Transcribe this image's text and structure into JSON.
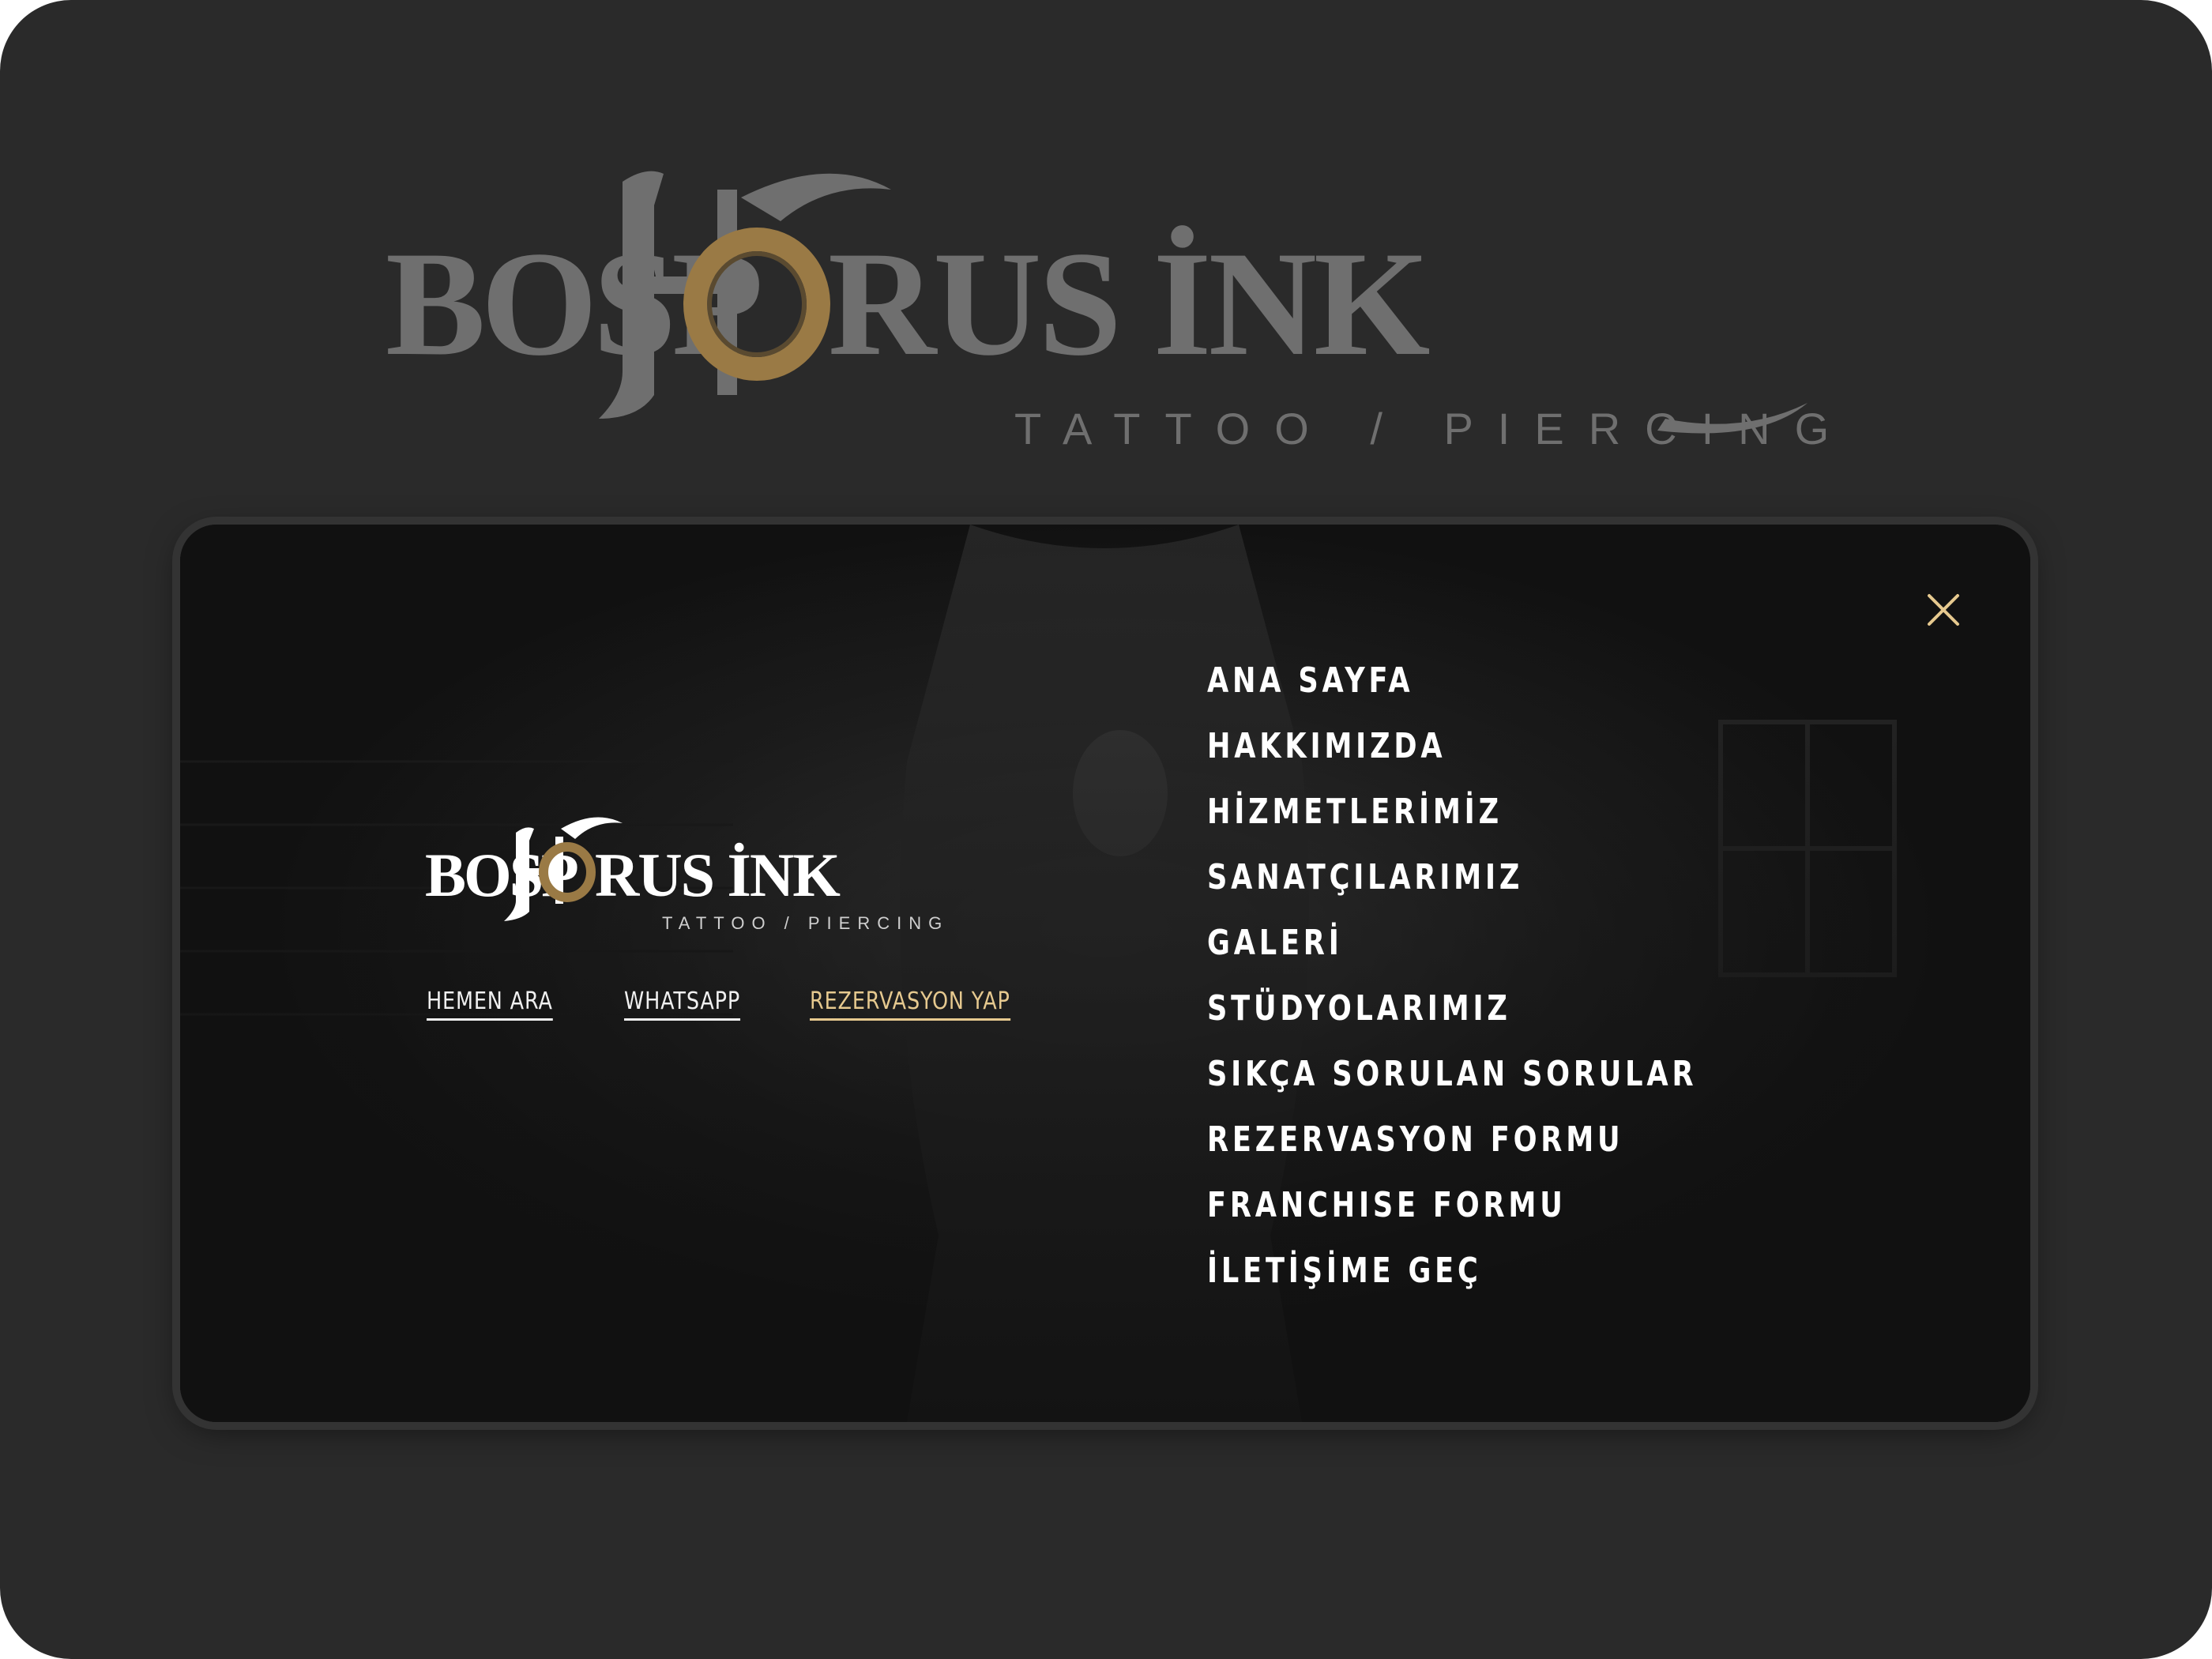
{
  "brand": {
    "name_left": "BOSP",
    "name_mid": "H",
    "name_o": "O",
    "name_right": "RUS İNK",
    "tagline": "TATTOO / PIERCING",
    "gold_color": "#9a7a45",
    "gray_color": "#6f6f6f"
  },
  "modal": {
    "close_icon": "close-icon",
    "close_color": "#e6c98f",
    "quick_links": [
      {
        "label": "HEMEN ARA"
      },
      {
        "label": "WHATSAPP"
      },
      {
        "label": "REZERVASYON YAP"
      }
    ],
    "accent_color": "#e6c98f",
    "menu": [
      {
        "label": "ANA SAYFA"
      },
      {
        "label": "HAKKIMIZDA"
      },
      {
        "label": "HİZMETLERİMİZ"
      },
      {
        "label": "SANATÇILARIMIZ"
      },
      {
        "label": "GALERİ"
      },
      {
        "label": "STÜDYOLARIMIZ"
      },
      {
        "label": "SIKÇA SORULAN SORULAR"
      },
      {
        "label": "REZERVASYON FORMU"
      },
      {
        "label": "FRANCHISE FORMU"
      },
      {
        "label": "İLETİŞİME GEÇ"
      }
    ]
  }
}
